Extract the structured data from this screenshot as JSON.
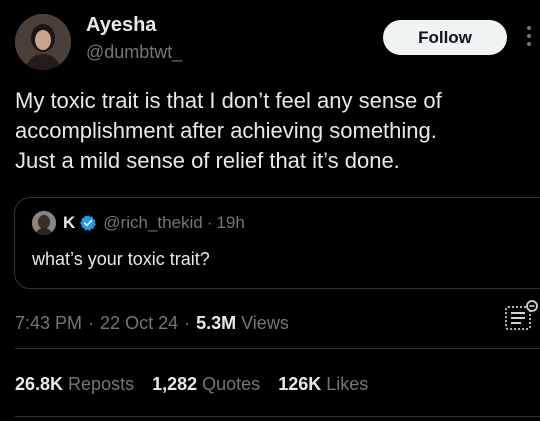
{
  "author": {
    "display_name": "Ayesha",
    "handle": "@dumbtwt_",
    "follow_label": "Follow"
  },
  "tweet": {
    "lines": [
      "My toxic trait is that I don’t feel any sense of",
      "accomplishment after achieving something.",
      "Just a mild sense of relief that it’s done."
    ]
  },
  "quoted": {
    "display_name": "K",
    "handle": "@rich_thekid",
    "separator": "·",
    "age": "19h",
    "text": "what’s your toxic trait?"
  },
  "meta": {
    "time": "7:43 PM",
    "date": "22 Oct 24",
    "separator": "·",
    "views_count": "5.3M",
    "views_label": "Views"
  },
  "stats": {
    "reposts_count": "26.8K",
    "reposts_label": "Reposts",
    "quotes_count": "1,282",
    "quotes_label": "Quotes",
    "likes_count": "126K",
    "likes_label": "Likes"
  },
  "icons": {
    "more": "more-options-icon",
    "verified": "verified-badge-icon",
    "stats": "view-analytics-icon"
  },
  "colors": {
    "background": "#000000",
    "text": "#e7e9ea",
    "secondary": "#71767b",
    "verified": "#1d9bf0",
    "border": "#2f3336",
    "follow_bg": "#eff3f4"
  }
}
